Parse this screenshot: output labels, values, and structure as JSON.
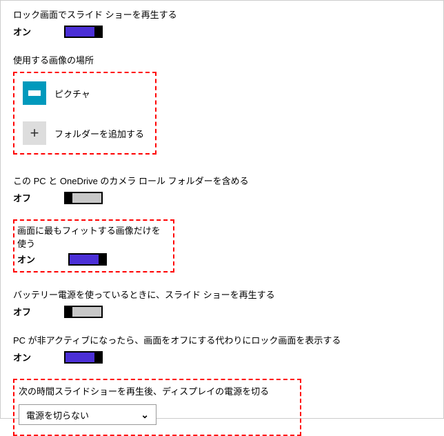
{
  "slideshow_play": {
    "label": "ロック画面でスライド ショーを再生する",
    "state": "オン"
  },
  "folders": {
    "heading": "使用する画像の場所",
    "pictures_label": "ピクチャ",
    "add_label": "フォルダーを追加する"
  },
  "cameraroll": {
    "label": "この PC と OneDrive のカメラ ロール フォルダーを含める",
    "state": "オフ"
  },
  "fit": {
    "label": "画面に最もフィットする画像だけを使う",
    "state": "オン"
  },
  "battery": {
    "label": "バッテリー電源を使っているときに、スライド ショーを再生する",
    "state": "オフ"
  },
  "inactive": {
    "label": "PC が非アクティブになったら、画面をオフにする代わりにロック画面を表示する",
    "state": "オン"
  },
  "timer": {
    "label": "次の時間スライドショーを再生後、ディスプレイの電源を切る",
    "selected": "電源を切らない"
  }
}
